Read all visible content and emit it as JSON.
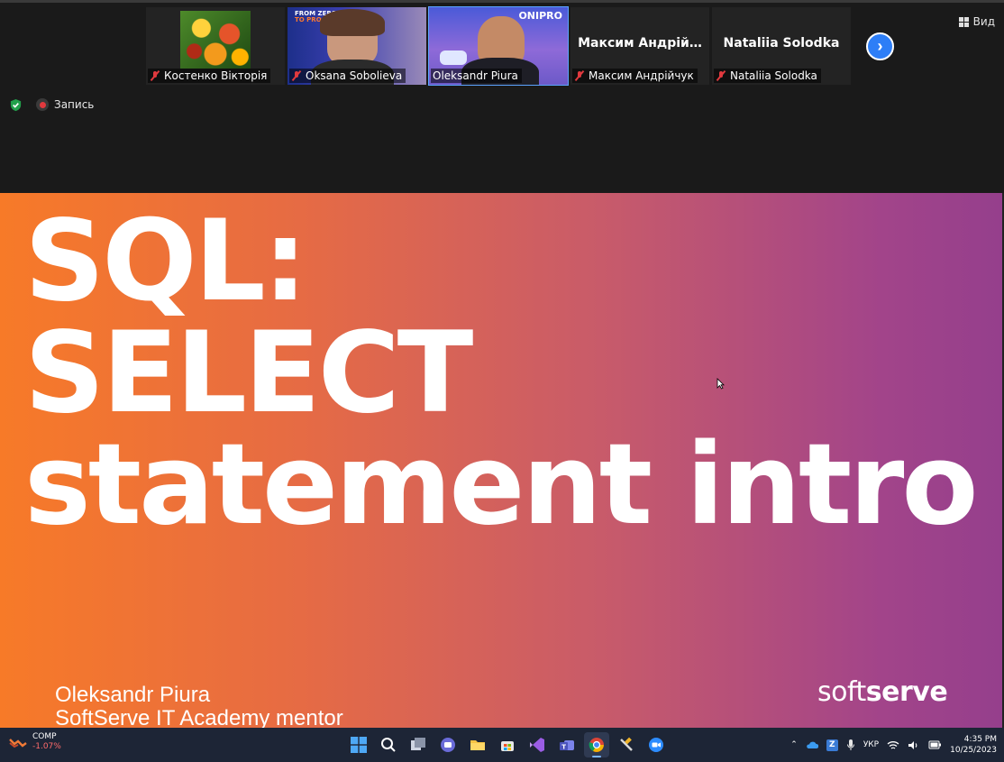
{
  "view_button": {
    "label": "Вид",
    "icon": "grid-icon"
  },
  "participants": [
    {
      "name": "Костенко Вікторія",
      "mic_muted": true,
      "video": "autumn-leaves"
    },
    {
      "name": "Oksana Sobolieva",
      "mic_muted": true,
      "video": "camera"
    },
    {
      "name": "Oleksandr Piura",
      "mic_muted": false,
      "video": "camera",
      "active_speaker": true
    },
    {
      "name": "Максим Андрійчук",
      "display_name": "Максим  Андрій…",
      "mic_muted": true,
      "video": "off"
    },
    {
      "name": "Nataliia Solodka",
      "display_name": "Nataliia Solodka",
      "mic_muted": true,
      "video": "off"
    }
  ],
  "tile_text": {
    "oksana_slide_line1": "FROM ZERO",
    "oksana_slide_line2": "TO",
    "oksana_slide_pro": "PRO",
    "oleks_banner": "ONIPRO"
  },
  "next_page_icon": "chevron-right-icon",
  "recording": {
    "label": "Запись",
    "icon": "record-icon"
  },
  "security_icon": "shield-check-icon",
  "slide": {
    "title_lines": [
      "SQL:",
      "SELECT",
      "statement intro"
    ],
    "author_name": "Oleksandr Piura",
    "author_role": "SoftServe IT Academy mentor",
    "brand_light": "soft",
    "brand_bold": "serve",
    "gradient_start": "#f77a28",
    "gradient_end": "#953f8c"
  },
  "taskbar": {
    "stock": {
      "ticker": "COMP",
      "change": "-1.07%"
    },
    "apps": [
      "windows-start-icon",
      "search-icon",
      "task-view-icon",
      "chat-icon",
      "file-explorer-icon",
      "store-icon",
      "visual-studio-icon",
      "teams-icon",
      "chrome-icon",
      "tools-icon",
      "zoom-icon"
    ],
    "language": "УКР",
    "time": "4:35 PM",
    "date": "10/25/2023"
  }
}
